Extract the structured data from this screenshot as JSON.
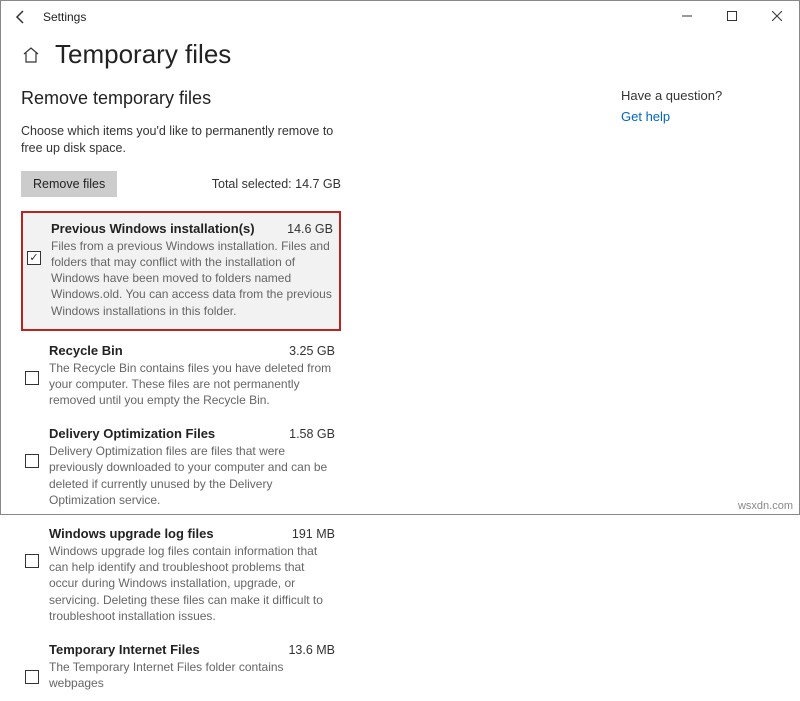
{
  "window": {
    "title": "Settings"
  },
  "page": {
    "title": "Temporary files",
    "subheading": "Remove temporary files",
    "instruction": "Choose which items you'd like to permanently remove to free up disk space.",
    "removeBtn": "Remove files",
    "totalLabel": "Total selected: 14.7 GB"
  },
  "help": {
    "question": "Have a question?",
    "link": "Get help"
  },
  "items": [
    {
      "title": "Previous Windows installation(s)",
      "size": "14.6 GB",
      "desc": "Files from a previous Windows installation.  Files and folders that may conflict with the installation of Windows have been moved to folders named Windows.old.  You can access data from the previous Windows installations in this folder.",
      "checked": true,
      "highlighted": true
    },
    {
      "title": "Recycle Bin",
      "size": "3.25 GB",
      "desc": "The Recycle Bin contains files you have deleted from your computer. These files are not permanently removed until you empty the Recycle Bin.",
      "checked": false,
      "highlighted": false
    },
    {
      "title": "Delivery Optimization Files",
      "size": "1.58 GB",
      "desc": "Delivery Optimization files are files that were previously downloaded to your computer and can be deleted if currently unused by the Delivery Optimization service.",
      "checked": false,
      "highlighted": false
    },
    {
      "title": "Windows upgrade log files",
      "size": "191 MB",
      "desc": "Windows upgrade log files contain information that can help identify and troubleshoot problems that occur during Windows installation, upgrade, or servicing.  Deleting these files can make it difficult to troubleshoot installation issues.",
      "checked": false,
      "highlighted": false
    },
    {
      "title": "Temporary Internet Files",
      "size": "13.6 MB",
      "desc": "The Temporary Internet Files folder contains webpages",
      "checked": false,
      "highlighted": false
    }
  ],
  "watermark": "wsxdn.com"
}
